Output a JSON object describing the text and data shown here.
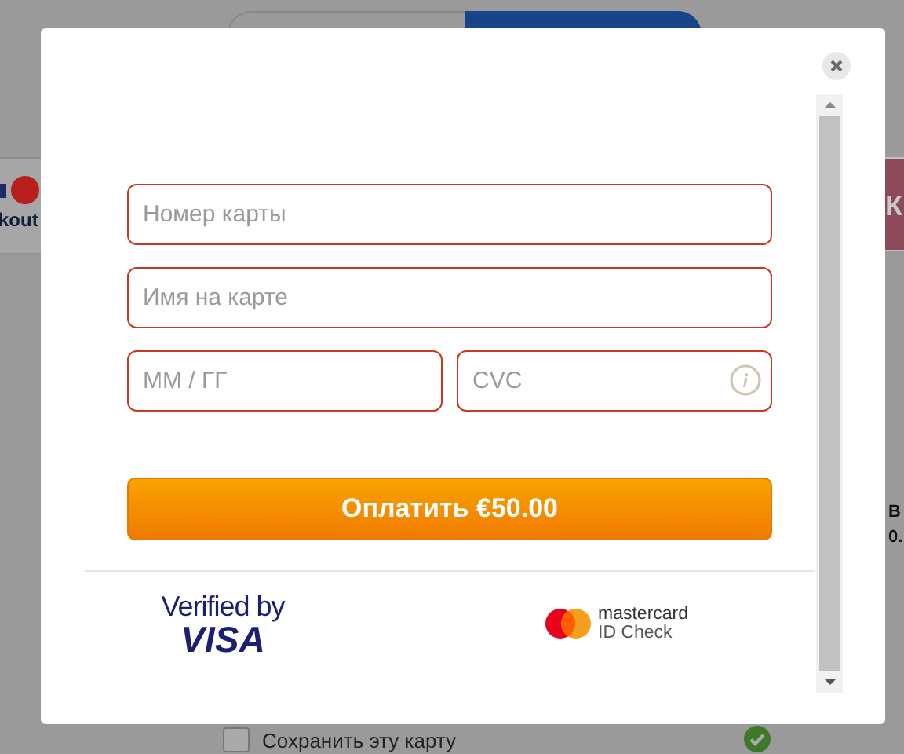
{
  "background": {
    "tabs": [
      {
        "selected": false
      },
      {
        "selected": true
      }
    ],
    "payment_logos_text": "kout",
    "side_button": {
      "label": "К"
    },
    "side_text": [
      "В",
      "0."
    ],
    "save_card": {
      "label": "Сохранить эту карту",
      "checked": false
    },
    "save_card_status": {
      "ok": true
    }
  },
  "modal": {
    "fields": [
      {
        "kind": "wide",
        "placeholder": "Номер карты",
        "error": true
      },
      {
        "kind": "wide",
        "placeholder": "Имя на карте",
        "error": true
      },
      {
        "kind": "half",
        "placeholder": "MM / ГГ",
        "error": true
      },
      {
        "kind": "half",
        "placeholder": "CVC",
        "error": true,
        "info": true
      }
    ],
    "pay_button": {
      "label": "Оплатить €50.00"
    },
    "badges": [
      {
        "kind": "visa",
        "line1": "Verified by",
        "line2": "VISA"
      },
      {
        "kind": "mastercard",
        "line1": "mastercard",
        "line2": "ID Check"
      }
    ]
  }
}
